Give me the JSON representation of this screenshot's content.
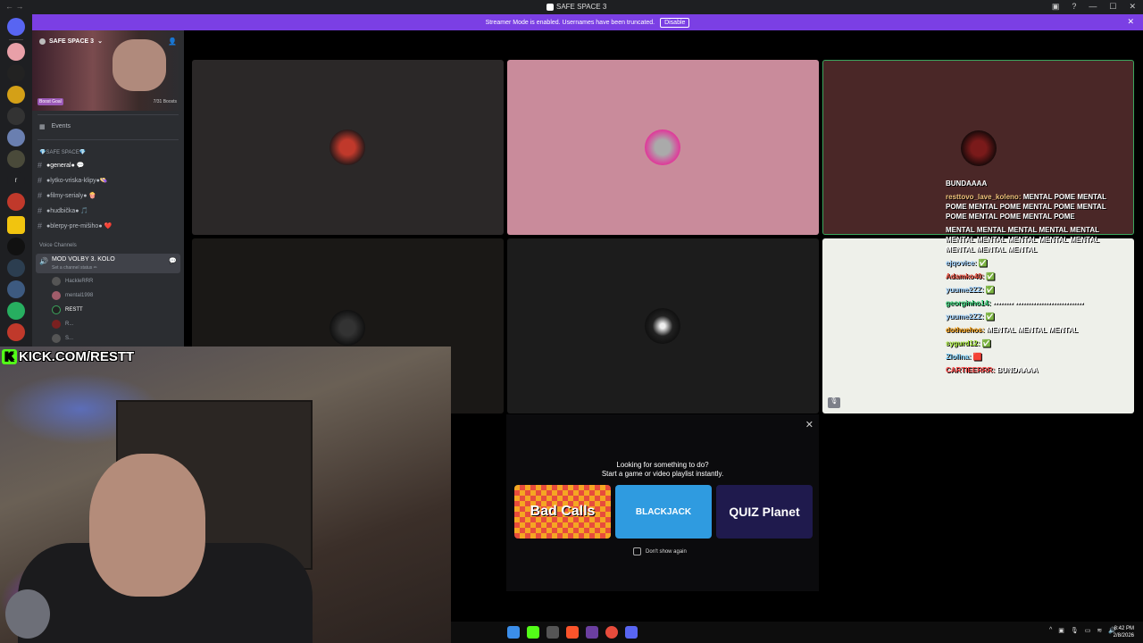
{
  "window": {
    "title": "SAFE SPACE 3"
  },
  "banner": {
    "text": "Streamer Mode is enabled. Usernames have been truncated.",
    "disable_label": "Disable",
    "close": "✕"
  },
  "server": {
    "name": "SAFE SPACE 3",
    "boost_label": "Boost Goal",
    "boost_count": "7/31 Boosts"
  },
  "sidebar": {
    "events": "Events",
    "category": "💎SAFE SPACE💎",
    "channels": [
      {
        "name": "●general● 💬",
        "active": true
      },
      {
        "name": "●lytko-vriska-klipy●👒",
        "active": false
      },
      {
        "name": "●filmy-serialy● 🍿",
        "active": false
      },
      {
        "name": "●hudbička● 🎵",
        "active": false
      },
      {
        "name": "●blerpy-pre-mišiho● ❤️",
        "active": false
      }
    ],
    "voice_category": "Voice Channels",
    "voice_channel": {
      "name": "MOD VOLBY 3. KOLO",
      "status": "Set a channel status ✏"
    },
    "voice_users": [
      "HackleRRR",
      "mental1998",
      "RESTT",
      "R...",
      "S..."
    ]
  },
  "stream_overlay": {
    "brand": "K",
    "url": "KICK.COM/RESTT"
  },
  "activity": {
    "title": "Looking for something to do?",
    "subtitle": "Start a game or video playlist instantly.",
    "cards": [
      "Bad Calls",
      "BLACKJACK",
      "QUIZ Planet"
    ],
    "dont_show": "Don't show again",
    "close": "✕"
  },
  "chat": [
    {
      "user": "",
      "text": "BUNDAAAA"
    },
    {
      "user": "resttovo_lave_koleno:",
      "text": "MENTAL POME MENTAL POME MENTAL POME MENTAL POME MENTAL POME MENTAL POME MENTAL POME"
    },
    {
      "user": "",
      "text": "MENTAL MENTAL MENTAL MENTAL MENTAL MENTAL MENTAL MENTAL MENTAL MENTAL MENTAL MENTAL MENTAL"
    },
    {
      "user": "ejqovice:",
      "text": "✅"
    },
    {
      "user": "Adamko40:",
      "text": "✅"
    },
    {
      "user": "yuume2ZZ:",
      "text": "✅"
    },
    {
      "user": "georginho14:",
      "text": "▪▪▪▪▪▪▪▪ ▪▪▪▪▪▪▪▪▪▪▪▪▪▪▪▪▪▪▪▪▪▪▪▪▪▪▪"
    },
    {
      "user": "yuume2ZZ:",
      "text": "✅"
    },
    {
      "user": "dothuehos:",
      "text": "MENTAL MENTAL MENTAL"
    },
    {
      "user": "sygurd12:",
      "text": "✅"
    },
    {
      "user": "Zlolina:",
      "text": "🟥"
    },
    {
      "user": "CARTIEERRR:",
      "text": "BUNDAAAA"
    }
  ],
  "taskbar": {
    "time": "8:42 PM",
    "date": "2/8/2026"
  }
}
